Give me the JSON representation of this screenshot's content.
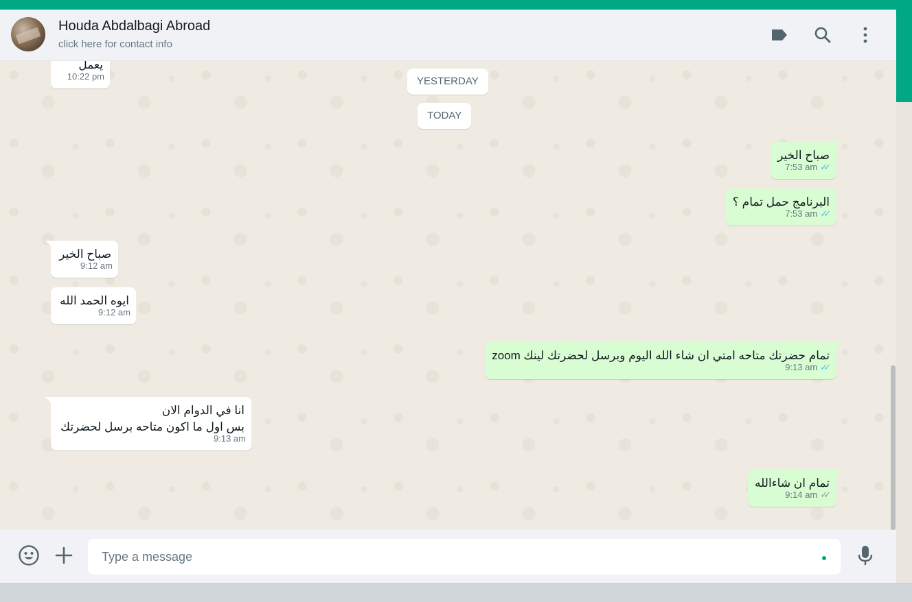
{
  "header": {
    "contact_name": "Houda Abdalbagi Abroad",
    "contact_subtitle": "click here for contact info",
    "icons": [
      "label-icon",
      "search-icon",
      "menu-icon"
    ]
  },
  "date_separators": {
    "yesterday": "YESTERDAY",
    "today": "TODAY"
  },
  "messages": [
    {
      "direction": "in",
      "text": "يعمل",
      "time": "10:22 pm"
    },
    {
      "direction": "out",
      "text": "صباح الخير",
      "time": "7:53 am",
      "status": "read"
    },
    {
      "direction": "out",
      "text": "البرنامج حمل تمام ؟",
      "time": "7:53 am",
      "status": "read"
    },
    {
      "direction": "in",
      "text": "صباح الخير",
      "time": "9:12 am"
    },
    {
      "direction": "in",
      "text": "ايوه  الحمد الله",
      "time": "9:12 am"
    },
    {
      "direction": "out",
      "text": "تمام حضرتك متاحه امتي ان شاء الله اليوم وبرسل لحضرتك لينك zoom",
      "time": "9:13 am",
      "status": "read"
    },
    {
      "direction": "in",
      "line1": "انا في الدوام  الان",
      "line2": "بس اول ما اكون  متاحه برسل لحضرتك",
      "time": "9:13 am"
    },
    {
      "direction": "out",
      "text": "تمام ان شاءالله",
      "time": "9:14 am",
      "status": "delivered"
    }
  ],
  "composer": {
    "placeholder": "Type a message",
    "icons": [
      "emoji-icon",
      "attach-plus-icon",
      "microphone-icon"
    ]
  },
  "colors": {
    "accent": "#00a884",
    "outgoing_bubble": "#d9fdd3",
    "incoming_bubble": "#ffffff",
    "read_ticks": "#53bdeb"
  }
}
